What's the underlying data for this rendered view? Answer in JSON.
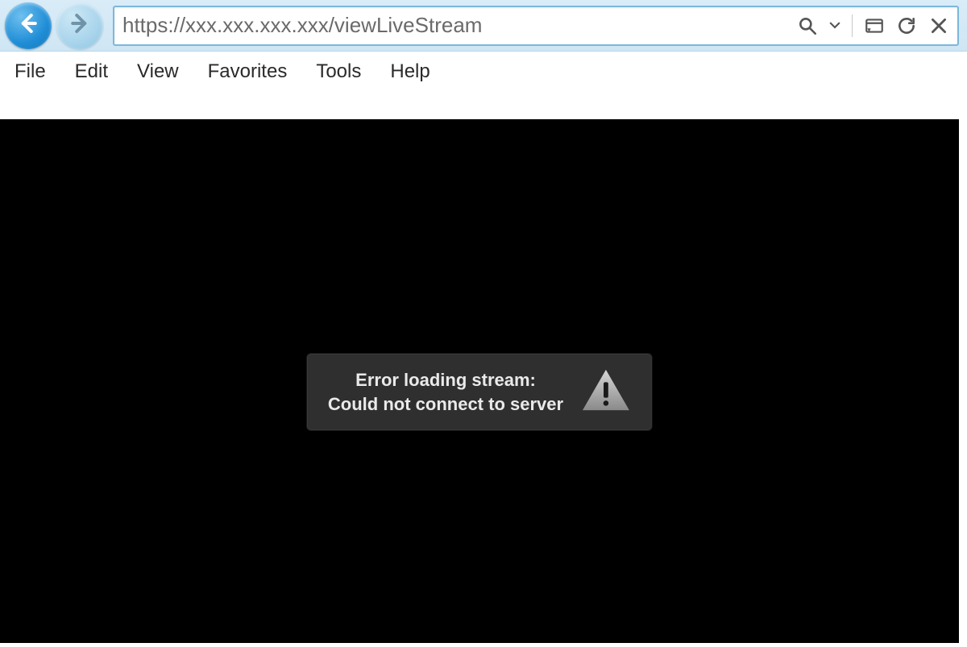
{
  "toolbar": {
    "address": "https://xxx.xxx.xxx.xxx/viewLiveStream"
  },
  "menubar": {
    "items": [
      "File",
      "Edit",
      "View",
      "Favorites",
      "Tools",
      "Help"
    ]
  },
  "player": {
    "error_line1": "Error loading stream:",
    "error_line2": "Could not connect to server"
  }
}
